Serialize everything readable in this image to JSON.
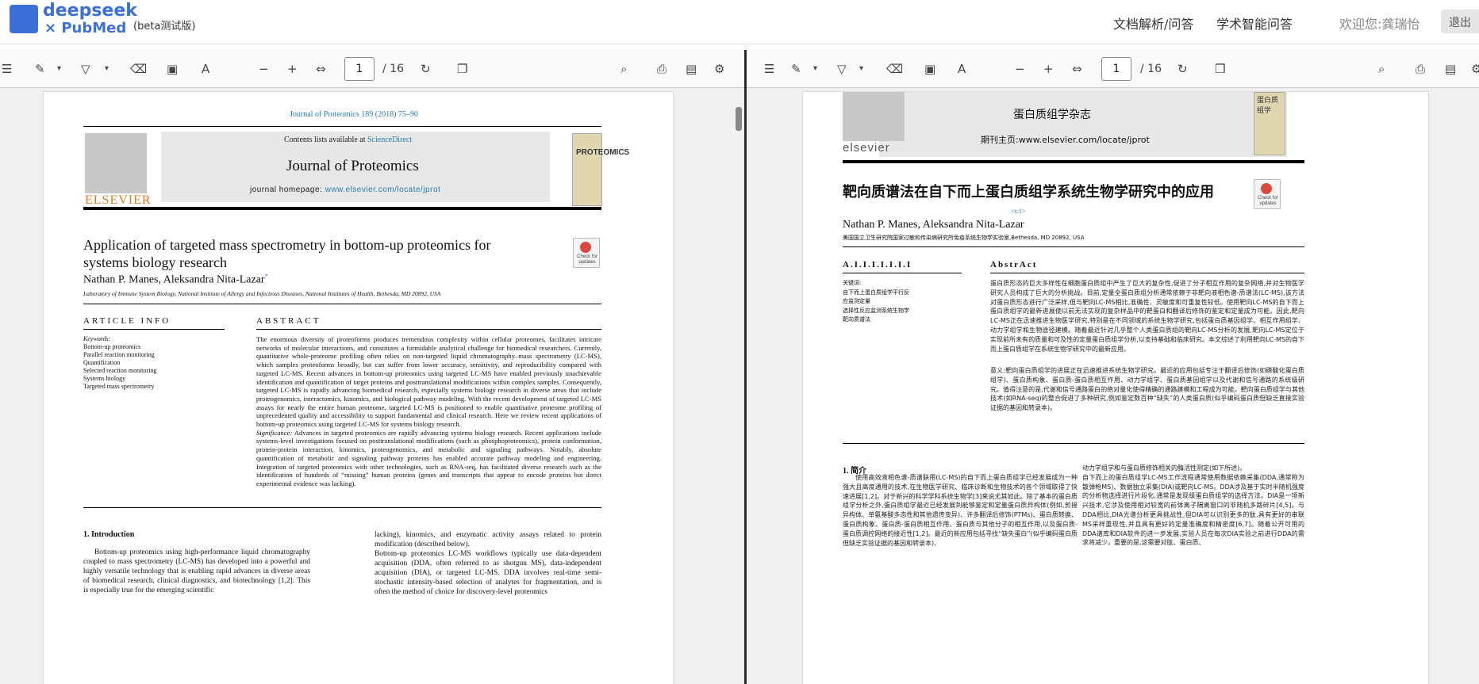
{
  "app": {
    "logo_line1": "deepseek",
    "logo_line2": "× PubMed",
    "beta": "(beta测试版)",
    "nav": [
      "文档解析/问答",
      "学术智能问答"
    ],
    "welcome": "欢迎您:龚瑞怡",
    "nav_button": "退出"
  },
  "viewer": {
    "page": "1",
    "page_count": "/ 16"
  },
  "left": {
    "journal_ref": "Journal of Proteomics 189 (2018) 75–90",
    "contents_pre": "Contents lists available at ",
    "contents_link": "ScienceDirect",
    "journal": "Journal of Proteomics",
    "homepage_pre": "journal homepage: ",
    "homepage_link": "www.elsevier.com/locate/jprot",
    "elsevier": "ELSEVIER",
    "cover_title": "PROTEOMICS",
    "title_l1": "Application of targeted mass spectrometry in bottom-up proteomics for",
    "title_l2": "systems biology research",
    "badge": "Check for updates",
    "authors": "Nathan P. Manes, Aleksandra Nita-Lazar",
    "author_mark": "*",
    "affil": "Laboratory of Immune System Biology, National Institute of Allergy and Infectious Diseases, National Institutes of Health, Bethesda, MD 20892, USA",
    "info_head": "ARTICLE INFO",
    "abstract_head": "ABSTRACT",
    "kw_head": "Keywords:",
    "keywords": [
      "Bottom-up proteomics",
      "Parallel reaction monitoring",
      "Quantification",
      "Selected reaction monitoring",
      "Systems biology",
      "Targeted mass spectrometry"
    ],
    "abstract": "The enormous diversity of proteoforms produces tremendous complexity within cellular proteomes, facilitates intricate networks of molecular interactions, and constitutes a formidable analytical challenge for biomedical researchers. Currently, quantitative whole-proteome profiling often relies on non-targeted liquid chromatography–mass spectrometry (LC-MS), which samples proteoforms broadly, but can suffer from lower accuracy, sensitivity, and reproducibility compared with targeted LC-MS. Recent advances in bottom-up proteomics using targeted LC-MS have enabled previously unachievable identification and quantification of target proteins and posttranslational modifications within complex samples. Consequently, targeted LC-MS is rapidly advancing biomedical research, especially systems biology research in diverse areas that include proteogenomics, interactomics, kinomics, and biological pathway modeling. With the recent development of targeted LC-MS assays for nearly the entire human proteome, targeted LC-MS is positioned to enable quantitative proteome profiling of unprecedented quality and accessibility to support fundamental and clinical research. Here we review recent applications of bottom-up proteomics using targeted LC-MS for systems biology research.",
    "sig_label": "Significance:",
    "significance": " Advances in targeted proteomics are rapidly advancing systems biology research. Recent applications include systems-level investigations focused on posttranslational modifications (such as phosphoproteomics), protein conformation, protein-protein interaction, kinomics, proteogenomics, and metabolic and signaling pathways. Notably, absolute quantification of metabolic and signaling pathway proteins has enabled accurate pathway modeling and engineering. Integration of targeted proteomics with other technologies, such as RNA-seq, has facilitated diverse research such as the identification of hundreds of “missing” human proteins (genes and transcripts that appear to encode proteins but direct experimental evidence was lacking).",
    "intro_head": "1.  Introduction",
    "intro_c1": "Bottom-up proteomics using high-performance liquid chromatography coupled to mass spectrometry (LC-MS) has developed into a powerful and highly versatile technology that is enabling rapid advances in diverse areas of biomedical research, clinical diagnostics, and biotechnology [1,2]. This is especially true for the emerging scientific",
    "intro_c2": "lacking), kinomics, and enzymatic activity assays related to protein modification (described below).\n    Bottom-up proteomics LC-MS workflows typically use data-dependent acquisition (DDA, often referred to as shotgun MS), data-independent acquisition (DIA), or targeted LC-MS. DDA involves real-time semi-stochastic intensity-based selection of analytes for fragmentation, and is often the method of choice for discovery-level proteomics"
  },
  "right": {
    "journal": "蛋白质组学杂志",
    "homepage": "期刊主页:www.elsevier.com/locate/jprot",
    "elsevier": "elsevier",
    "cover_title": "蛋白质组学",
    "title": "靶向质谱法在自下而上蛋白质组学系统生物学研究中的应用",
    "sup": "<s:1>",
    "authors": "Nathan P. Manes, Aleksandra Nita-Lazar",
    "affil": "美国国立卫生研究院国家过敏和传染病研究所免疫系统生物学实验室,Bethesda, MD 20892, USA",
    "info_head": "A.I.I.I.I.I.I.I",
    "abstract_head": "AbstrAct",
    "kw_head": "关键词:",
    "keywords": [
      "自下而上蛋白质组学平行反",
      "应监测定量",
      "选择性反应监测系统生物学",
      "",
      "靶向质谱法"
    ],
    "abstract": "蛋白质形态的巨大多样性在细胞蛋白质组中产生了巨大的复杂性,促进了分子相互作用的复杂网络,并对生物医学研究人员构成了巨大的分析挑战。目前,定量全蛋白质组分析通常依赖于非靶向液相色谱-质谱法(LC-MS),该方法对蛋白质形态进行广泛采样,但与靶向LC-MS相比,准确性、灵敏度和可重复性较低。使用靶向LC-MS的自下而上蛋白质组学的最新进展使以前无法实现的复杂样品中的靶蛋白和翻译后修饰的鉴定和定量成为可能。因此,靶向LC-MS正在迅速推进生物医学研究,特别是在不同领域的系统生物学研究,包括蛋白质基因组学、相互作用组学、动力学组学和生物途径建模。随着最近针对几乎整个人类蛋白质组的靶向LC-MS分析的发展,靶向LC-MS定位于实现前所未有的质量和可及性的定量蛋白质组学分析,以支持基础和临床研究。本文综述了利用靶向LC-MS的自下而上蛋白质组学在系统生物学研究中的最新应用。",
    "significance": "意义:靶向蛋白质组学的进展正在迅速推进系统生物学研究。最近的应用包括专注于翻译后修饰(如磷酸化蛋白质组学)、蛋白质构象、蛋白质-蛋白质相互作用、动力学组学、蛋白质基因组学以及代谢和信号通路的系统级研究。值得注意的是,代谢和信号通路蛋白的绝对量化使得精确的通路建模和工程成为可能。靶向蛋白质组学与其他技术(如RNA-seq)的整合促进了多种研究,例如鉴定数百种“缺失”的人类蛋白质(似乎编码蛋白质但缺乏直接实验证据的基因和转录本)。",
    "intro_head": "1. 简介",
    "intro_c1": "使用高效液相色谱-质谱联用(LC-MS)的自下而上蛋白质组学已经发展成为一种强大且高度通用的技术,在生物医学研究、临床诊断和生物技术的各个领域取得了快速进展[1,2]。对于新兴的科学学科系统生物学[3]来说尤其如此。除了基本的蛋白质组学分析之外,蛋白质组学最近已经发展到能够鉴定和定量蛋白质异构体(例如,剪接异构体、单氨基酸多态性和其他遗传变异)、许多翻译后修饰(PTMs)、蛋白质转换、蛋白质构象、蛋白质-蛋白质相互作用、蛋白质与其他分子的相互作用,以及蛋白质-蛋白质调控网络的接近性[1,2]。最近的新应用包括寻找“缺失蛋白”(似乎编码蛋白质但缺乏实验证据的基因和转录本)、",
    "intro_c2": "动力学组学和与蛋白质修饰相关的酶活性测定(如下所述)。\n    自下而上的蛋白质组学LC-MS工作流程通常使用数据依赖采集(DDA,通常称为散弹枪MS)、数据独立采集(DIA)或靶向LC-MS。DDA涉及基于实时半随机强度的分析物选择进行片段化,通常是发现级蛋白质组学的选择方法。DIA是一项新兴技术,它涉及使用相对较宽的前体离子隔离窗口的非随机多路碎片[4,5]。与DDA相比,DIA光谱分析更具挑战性,但DIA可以识别更多的肽,具有更好的串联MS采样重现性,并且具有更好的定量准确度和精密度[6,7]。随着公开可用的DDA谱库和DIA软件的进一步发展,实验人员在每次DIA实验之前进行DDA的需求将减少。重要的是,这需要对肽、蛋白质、"
  }
}
